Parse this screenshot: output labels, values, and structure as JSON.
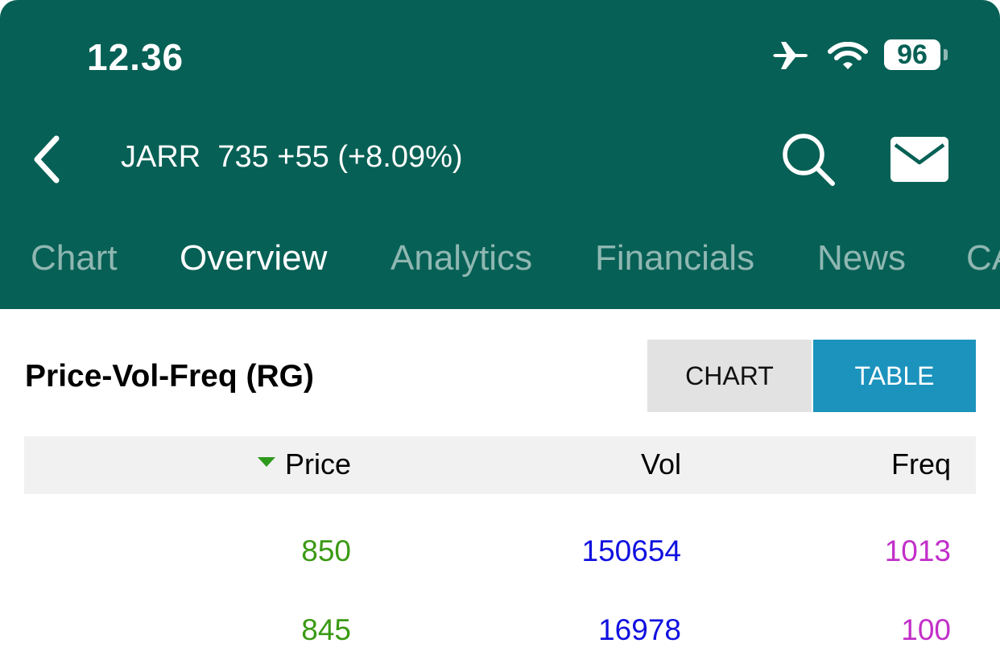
{
  "status_bar": {
    "time": "12.36",
    "battery": "96",
    "icons": [
      "airplane-icon",
      "wifi-icon",
      "battery-icon"
    ]
  },
  "header": {
    "ticker_text": "JARR  735 +55 (+8.09%)",
    "icons": [
      "chevron-left-icon",
      "search-icon",
      "mail-icon"
    ]
  },
  "tabs": [
    {
      "label": "Chart",
      "active": false
    },
    {
      "label": "Overview",
      "active": true
    },
    {
      "label": "Analytics",
      "active": false
    },
    {
      "label": "Financials",
      "active": false
    },
    {
      "label": "News",
      "active": false
    },
    {
      "label": "CA",
      "active": false
    }
  ],
  "section": {
    "title": "Price-Vol-Freq (RG)",
    "toggle": {
      "chart_label": "CHART",
      "table_label": "TABLE",
      "selected": "TABLE"
    }
  },
  "table": {
    "columns": [
      "Price",
      "Vol",
      "Freq"
    ],
    "sorted_by": "Price",
    "rows": [
      {
        "price": "850",
        "vol": "150654",
        "freq": "1013"
      },
      {
        "price": "845",
        "vol": "16978",
        "freq": "100"
      }
    ]
  },
  "colors": {
    "header_bg": "#076055",
    "toggle_active": "#1b93bd",
    "price_text": "#3a9a14",
    "vol_text": "#1010e0",
    "freq_text": "#c22fc9"
  }
}
